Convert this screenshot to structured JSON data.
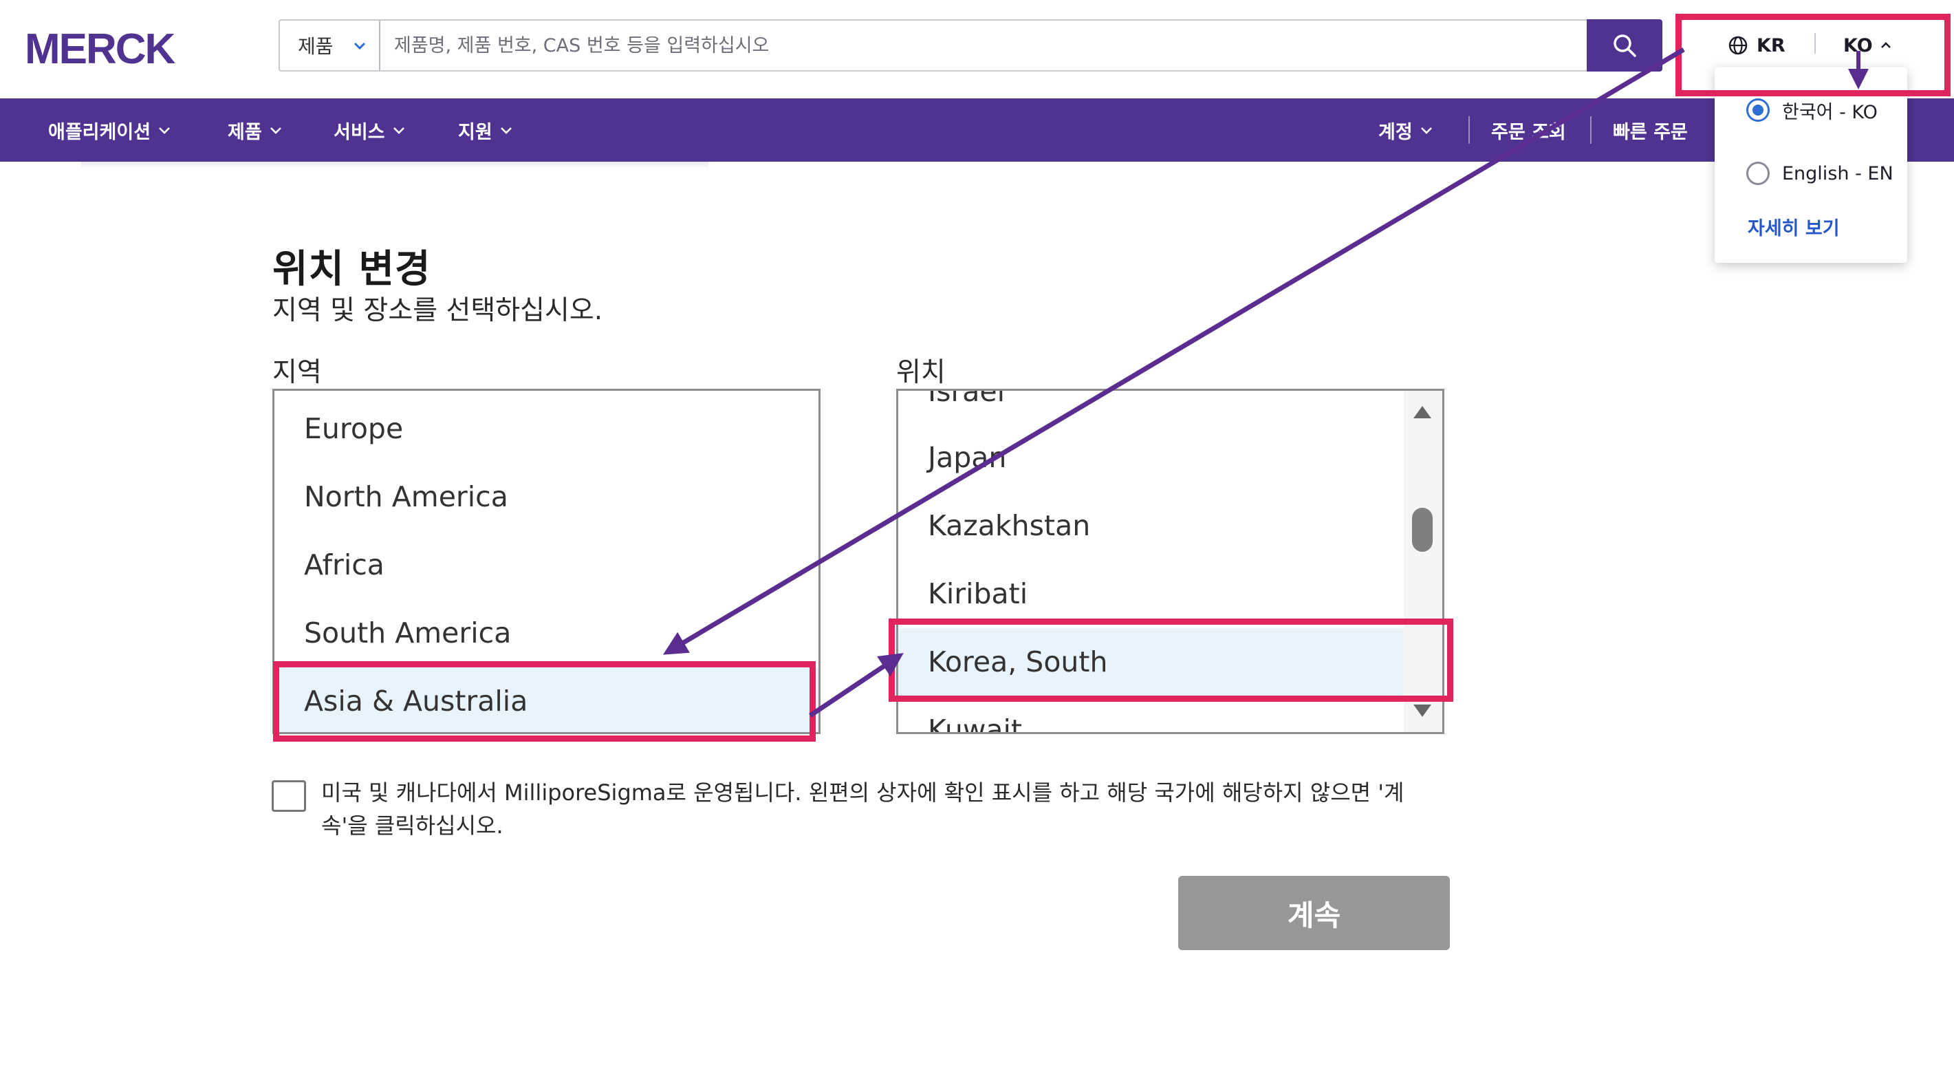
{
  "brand": {
    "logo_text": "MERCK",
    "color": "#503291"
  },
  "search": {
    "scope": "제품",
    "placeholder": "제품명, 제품 번호, CAS 번호 등을 입력하십시오"
  },
  "locale": {
    "region": "KR",
    "language": "KO"
  },
  "nav": {
    "left": [
      "애플리케이션",
      "제품",
      "서비스",
      "지원"
    ],
    "right": {
      "account": "계정",
      "orders": "주문 조회",
      "quick_order": "빠른 주문"
    }
  },
  "language_menu": {
    "options": [
      {
        "label": "한국어 - KO",
        "selected": true
      },
      {
        "label": "English - EN",
        "selected": false
      }
    ],
    "more": "자세히 보기"
  },
  "page": {
    "title": "위치 변경",
    "subtitle": "지역 및 장소를 선택하십시오.",
    "region_label": "지역",
    "location_label": "위치",
    "regions": [
      "Europe",
      "North America",
      "Africa",
      "South America",
      "Asia & Australia"
    ],
    "selected_region": "Asia & Australia",
    "locations": [
      "Israel",
      "Japan",
      "Kazakhstan",
      "Kiribati",
      "Korea, South",
      "Kuwait"
    ],
    "selected_location": "Korea, South",
    "confirm_text": "미국 및 캐나다에서 MilliporeSigma로 운영됩니다. 왼편의 상자에 확인 표시를 하고 해당 국가에 해당하지 않으면 '계속'을 클릭하십시오.",
    "continue_label": "계속"
  },
  "colors": {
    "nav_bg": "#503291",
    "highlight": "#e0245e",
    "arrow": "#5b2d91",
    "selected_row": "#e8f3fb",
    "button_disabled": "#979797"
  }
}
